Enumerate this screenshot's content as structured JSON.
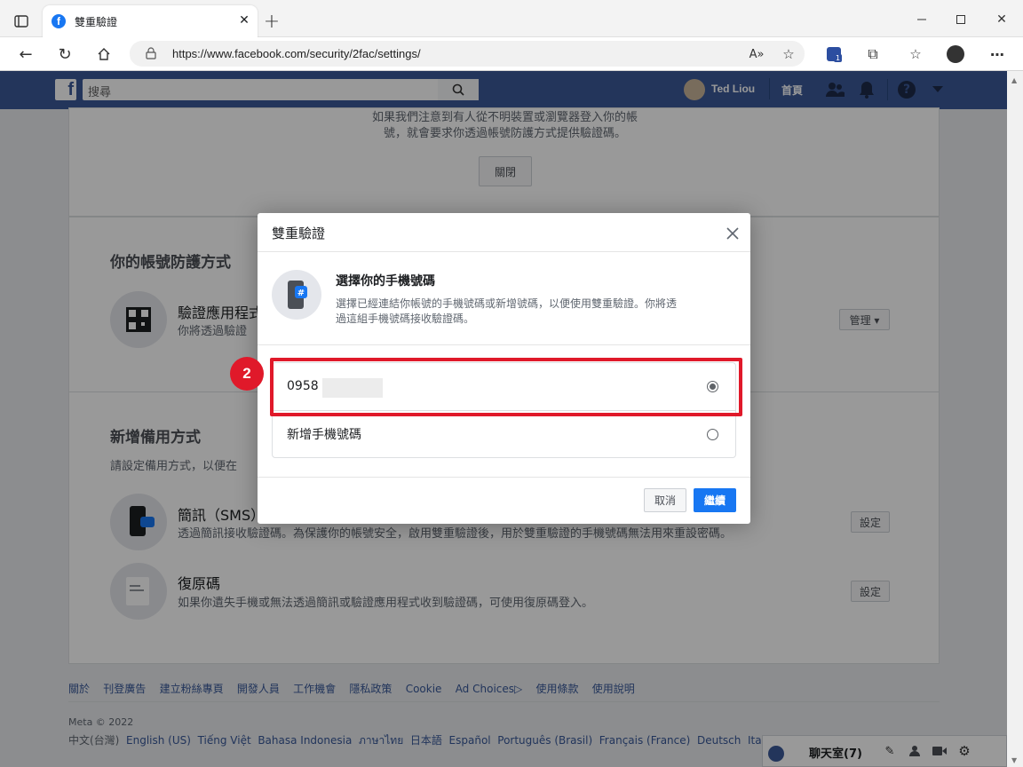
{
  "browser": {
    "tab_title": "雙重驗證",
    "url": "https://www.facebook.com/security/2fac/settings/",
    "ext_badge": "1"
  },
  "fb": {
    "search_placeholder": "搜尋",
    "user_name": "Ted Liou",
    "home_label": "首頁"
  },
  "page": {
    "top_text_1": "如果我們注意到有人從不明裝置或瀏覽器登入你的帳",
    "top_text_2": "號，就會要求你透過帳號防護方式提供驗證碼。",
    "close_button": "關閉",
    "protection_heading": "你的帳號防護方式",
    "auth_app_title": "驗證應用程式",
    "auth_app_desc": "你將透過驗證",
    "manage_button": "管理 ▾",
    "backup_heading": "新增備用方式",
    "backup_desc": "請設定備用方式，以便在",
    "sms_title": "簡訊（SMS）",
    "sms_desc": "透過簡訊接收驗證碼。為保護你的帳號安全，啟用雙重驗證後，用於雙重驗證的手機號碼無法用來重設密碼。",
    "sms_button": "設定",
    "recovery_title": "復原碼",
    "recovery_desc": "如果你遺失手機或無法透過簡訊或驗證應用程式收到驗證碼，可使用復原碼登入。",
    "recovery_button": "設定"
  },
  "footer": {
    "links": [
      "關於",
      "刊登廣告",
      "建立粉絲專頁",
      "開發人員",
      "工作機會",
      "隱私政策",
      "Cookie",
      "Ad Choices",
      "使用條款",
      "使用說明"
    ],
    "copyright": "Meta © 2022",
    "languages": [
      "中文(台灣)",
      "English (US)",
      "Tiếng Việt",
      "Bahasa Indonesia",
      "ภาษาไทย",
      "日本語",
      "Español",
      "Português (Brasil)",
      "Français (France)",
      "Deutsch",
      "Italian"
    ]
  },
  "chat": {
    "label": "聊天室(7)"
  },
  "dialog": {
    "title": "雙重驗證",
    "heading": "選擇你的手機號碼",
    "desc_1": "選擇已經連結你帳號的手機號碼或新增號碼，以便使用雙重驗證。你將透",
    "desc_2": "過這組手機號碼接收驗證碼。",
    "option_1": "0958",
    "option_2": "新增手機號碼",
    "cancel": "取消",
    "continue": "繼續"
  },
  "annotation": {
    "step": "2",
    "color": "#e0192a"
  },
  "colors": {
    "fb_blue": "#3b5998",
    "primary": "#1877f2"
  }
}
